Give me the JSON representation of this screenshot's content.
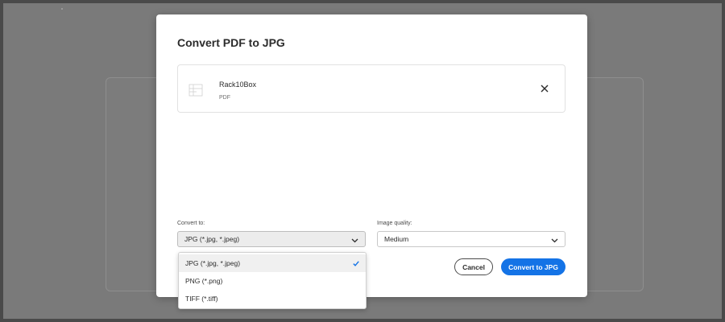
{
  "dialog": {
    "title": "Convert PDF to JPG"
  },
  "file": {
    "name": "Rack10Box",
    "type": "PDF"
  },
  "convert_to": {
    "label": "Convert to:",
    "selected": "JPG (*.jpg, *.jpeg)",
    "options": [
      {
        "label": "JPG (*.jpg, *.jpeg)",
        "selected": true
      },
      {
        "label": "PNG (*.png)",
        "selected": false
      },
      {
        "label": "TIFF (*.tiff)",
        "selected": false
      }
    ]
  },
  "image_quality": {
    "label": "Image quality:",
    "selected": "Medium"
  },
  "buttons": {
    "cancel": "Cancel",
    "convert": "Convert to JPG"
  },
  "colors": {
    "accent": "#1473e6",
    "overlay": "#7a7a7a"
  },
  "icons": {
    "file_thumb": "file-thumbnail-icon",
    "close": "close-icon",
    "chevron": "chevron-down-icon",
    "check": "checkmark-icon"
  }
}
